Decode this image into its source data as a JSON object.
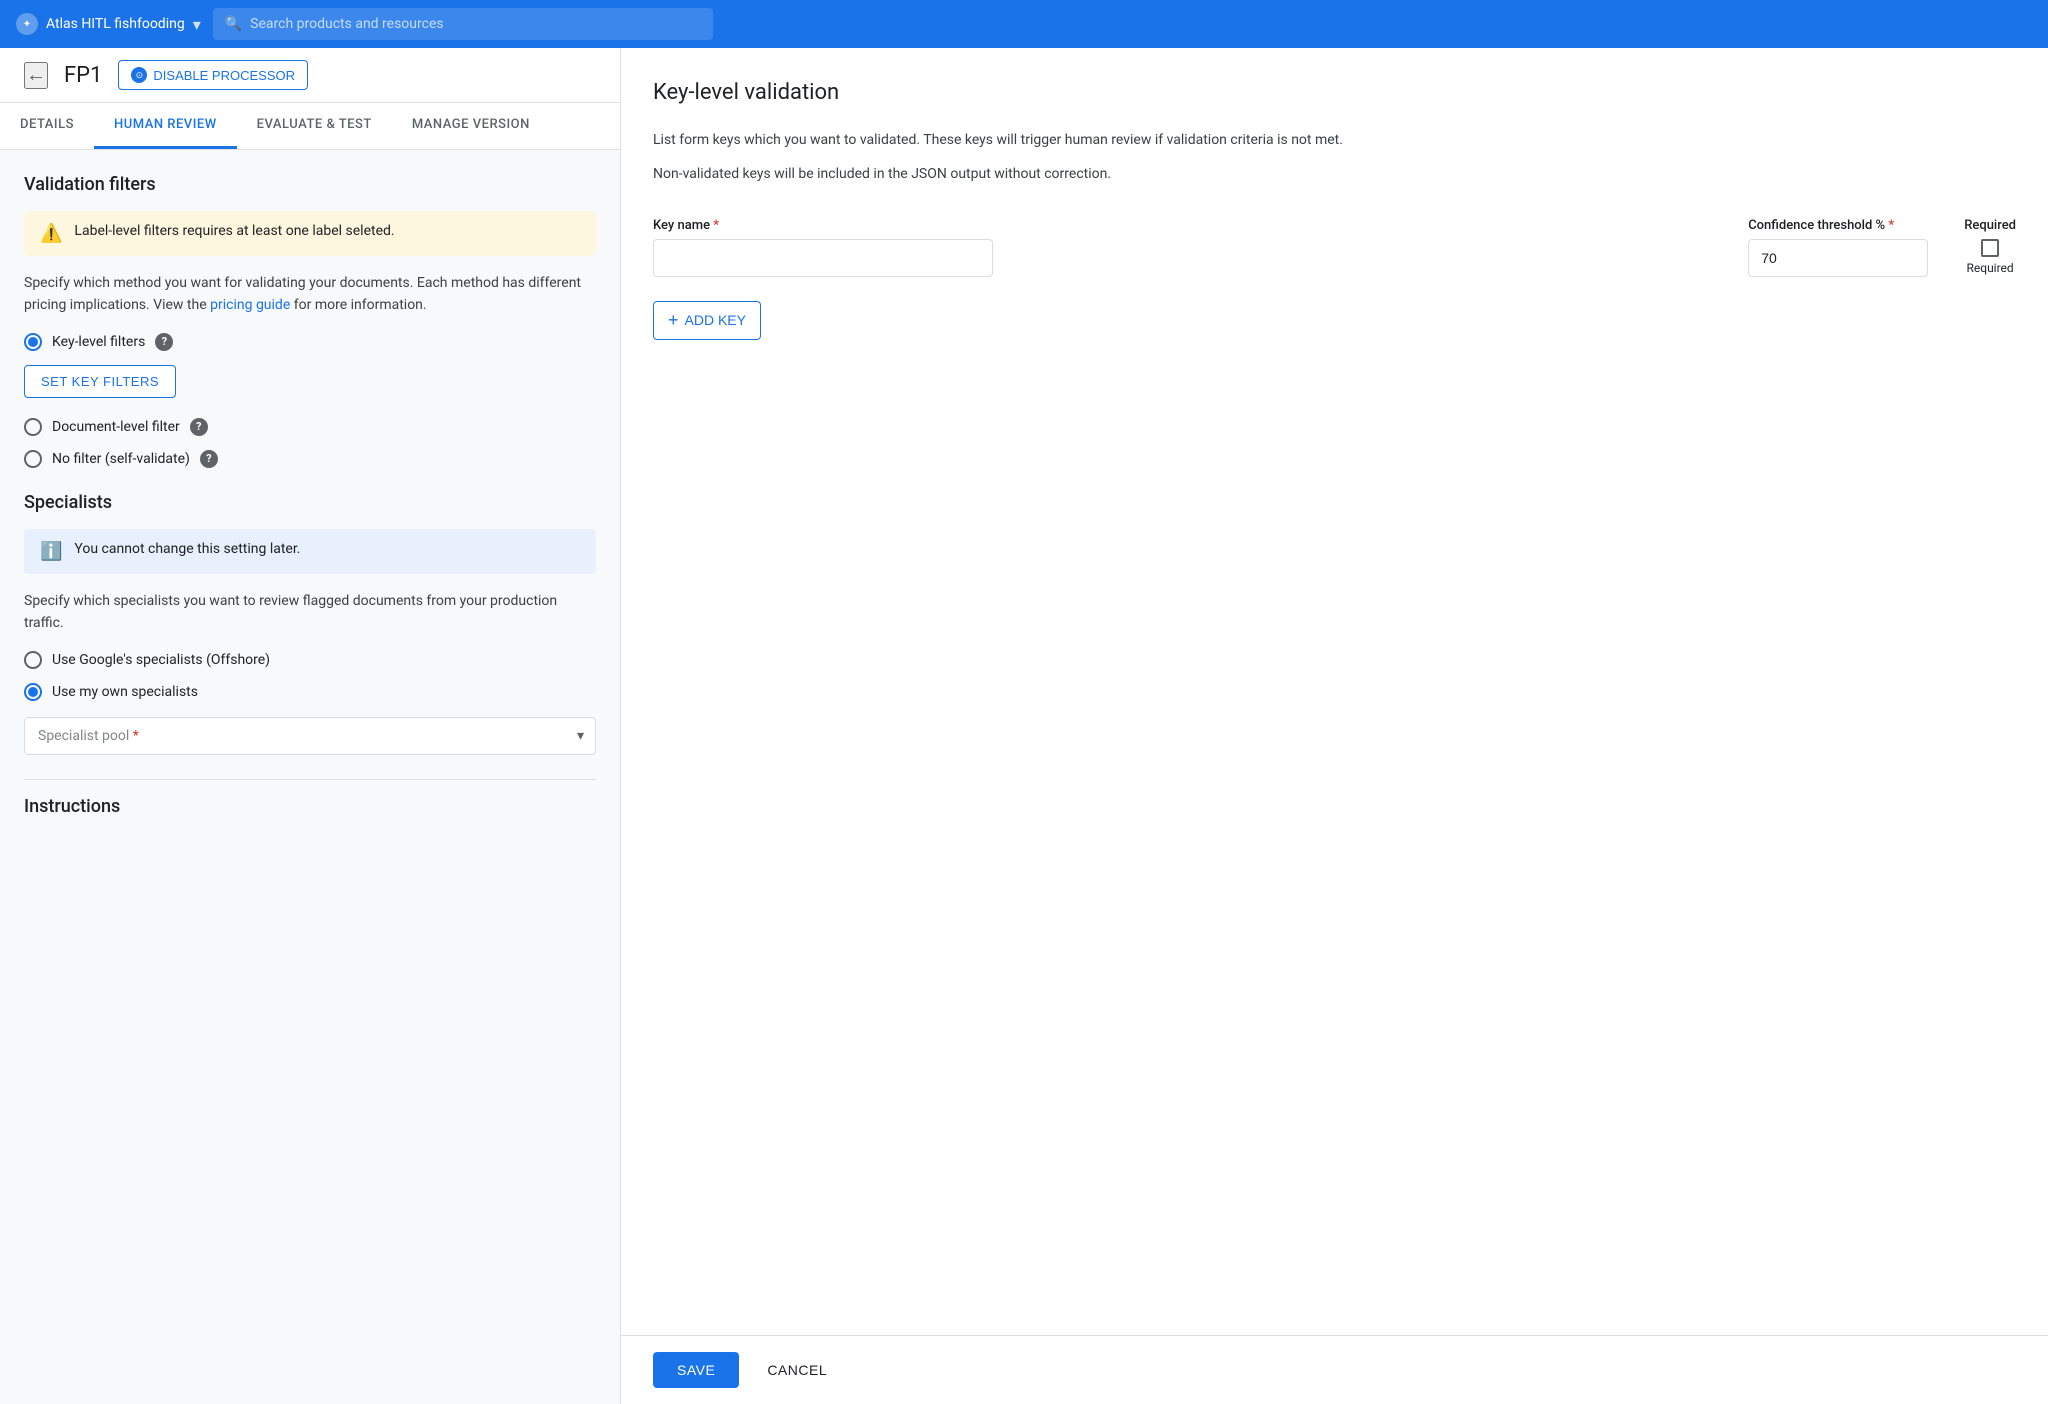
{
  "topnav": {
    "logo_text": "Atlas HITL fishfooding",
    "search_placeholder": "Search products and resources"
  },
  "subheader": {
    "page_title": "FP1",
    "disable_button_label": "DISABLE PROCESSOR"
  },
  "tabs": [
    {
      "id": "details",
      "label": "DETAILS",
      "active": false
    },
    {
      "id": "human-review",
      "label": "HUMAN REVIEW",
      "active": true
    },
    {
      "id": "evaluate-test",
      "label": "EVALUATE & TEST",
      "active": false
    },
    {
      "id": "manage-version",
      "label": "MANAGE VERSION",
      "active": false
    }
  ],
  "left_panel": {
    "validation_filters": {
      "section_title": "Validation filters",
      "alert_text": "Label-level filters requires at least one label seleted.",
      "description": "Specify which method you want for validating your documents. Each method has different pricing implications. View the",
      "pricing_link_text": "pricing guide",
      "description_suffix": "for more information.",
      "filters": [
        {
          "id": "key-level",
          "label": "Key-level filters",
          "selected": true,
          "has_help": true
        },
        {
          "id": "document-level",
          "label": "Document-level filter",
          "selected": false,
          "has_help": true
        },
        {
          "id": "no-filter",
          "label": "No filter (self-validate)",
          "selected": false,
          "has_help": true
        }
      ],
      "set_key_filters_label": "SET KEY FILTERS"
    },
    "specialists": {
      "section_title": "Specialists",
      "info_text": "You cannot change this setting later.",
      "description": "Specify which specialists you want to review flagged documents from your production traffic.",
      "options": [
        {
          "id": "google",
          "label": "Use Google's specialists (Offshore)",
          "selected": false
        },
        {
          "id": "own",
          "label": "Use my own specialists",
          "selected": true
        }
      ],
      "specialist_pool_label": "Specialist pool",
      "specialist_pool_placeholder": "Specialist pool *"
    },
    "instructions_label": "Instructions"
  },
  "right_panel": {
    "title": "Key-level validation",
    "description_1": "List form keys which you want to validated. These keys will trigger human review if validation criteria is not met.",
    "description_2": "Non-validated keys will be included in the JSON output without correction.",
    "form": {
      "key_name_label": "Key name",
      "key_name_required": true,
      "key_name_value": "",
      "confidence_label": "Confidence threshold %",
      "confidence_required": true,
      "confidence_value": "70",
      "required_label": "Required",
      "add_key_label": "ADD KEY"
    },
    "footer": {
      "save_label": "SAVE",
      "cancel_label": "CANCEL"
    }
  }
}
